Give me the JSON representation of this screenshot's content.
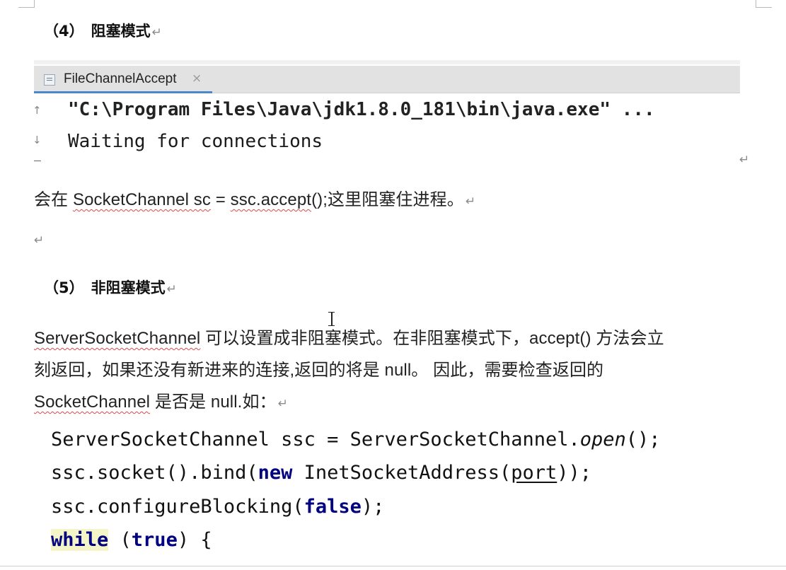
{
  "section4": {
    "number": "（4）",
    "title": "阻塞模式",
    "mark": "↵"
  },
  "console": {
    "tab_label": "FileChannelAccept",
    "tab_close": "×",
    "line1": "\"C:\\Program Files\\Java\\jdk1.8.0_181\\bin\\java.exe\" ...",
    "line2": "Waiting for connections",
    "gutter_up": "↑",
    "gutter_down": "↓"
  },
  "after_console_mark": "↵",
  "para_block": {
    "prefix": "会在 ",
    "code1": "SocketChannel sc",
    "middle": " = ",
    "code2": "ssc.accept",
    "suffix": "();这里阻塞住进程。",
    "mark": "↵"
  },
  "empty_mark": "↵",
  "section5": {
    "number": "（5）",
    "title": "非阻塞模式",
    "mark": "↵"
  },
  "para_nonblock": {
    "line1_code": "ServerSocketChannel",
    "line1_rest": " 可以设置成非阻塞模式。在非阻塞模式下，accept() 方法会立",
    "line2": "刻返回，如果还没有新进来的连接,返回的将是 null。 因此，需要检查返回的",
    "line3_code": "SocketChannel",
    "line3_rest": " 是否是 null.如：",
    "mark": "↵"
  },
  "code": {
    "l1_a": "ServerSocketChannel ssc = ServerSocketChannel.",
    "l1_b": "open",
    "l1_c": "();",
    "l2_a": "ssc.socket().bind(",
    "l2_kw": "new",
    "l2_b": " InetSocketAddress(",
    "l2_c": "port",
    "l2_d": "));",
    "l3_a": "ssc.configureBlocking(",
    "l3_kw": "false",
    "l3_b": ");",
    "l4_kw1": "while",
    "l4_a": " (",
    "l4_kw2": "true",
    "l4_b": ") {"
  }
}
